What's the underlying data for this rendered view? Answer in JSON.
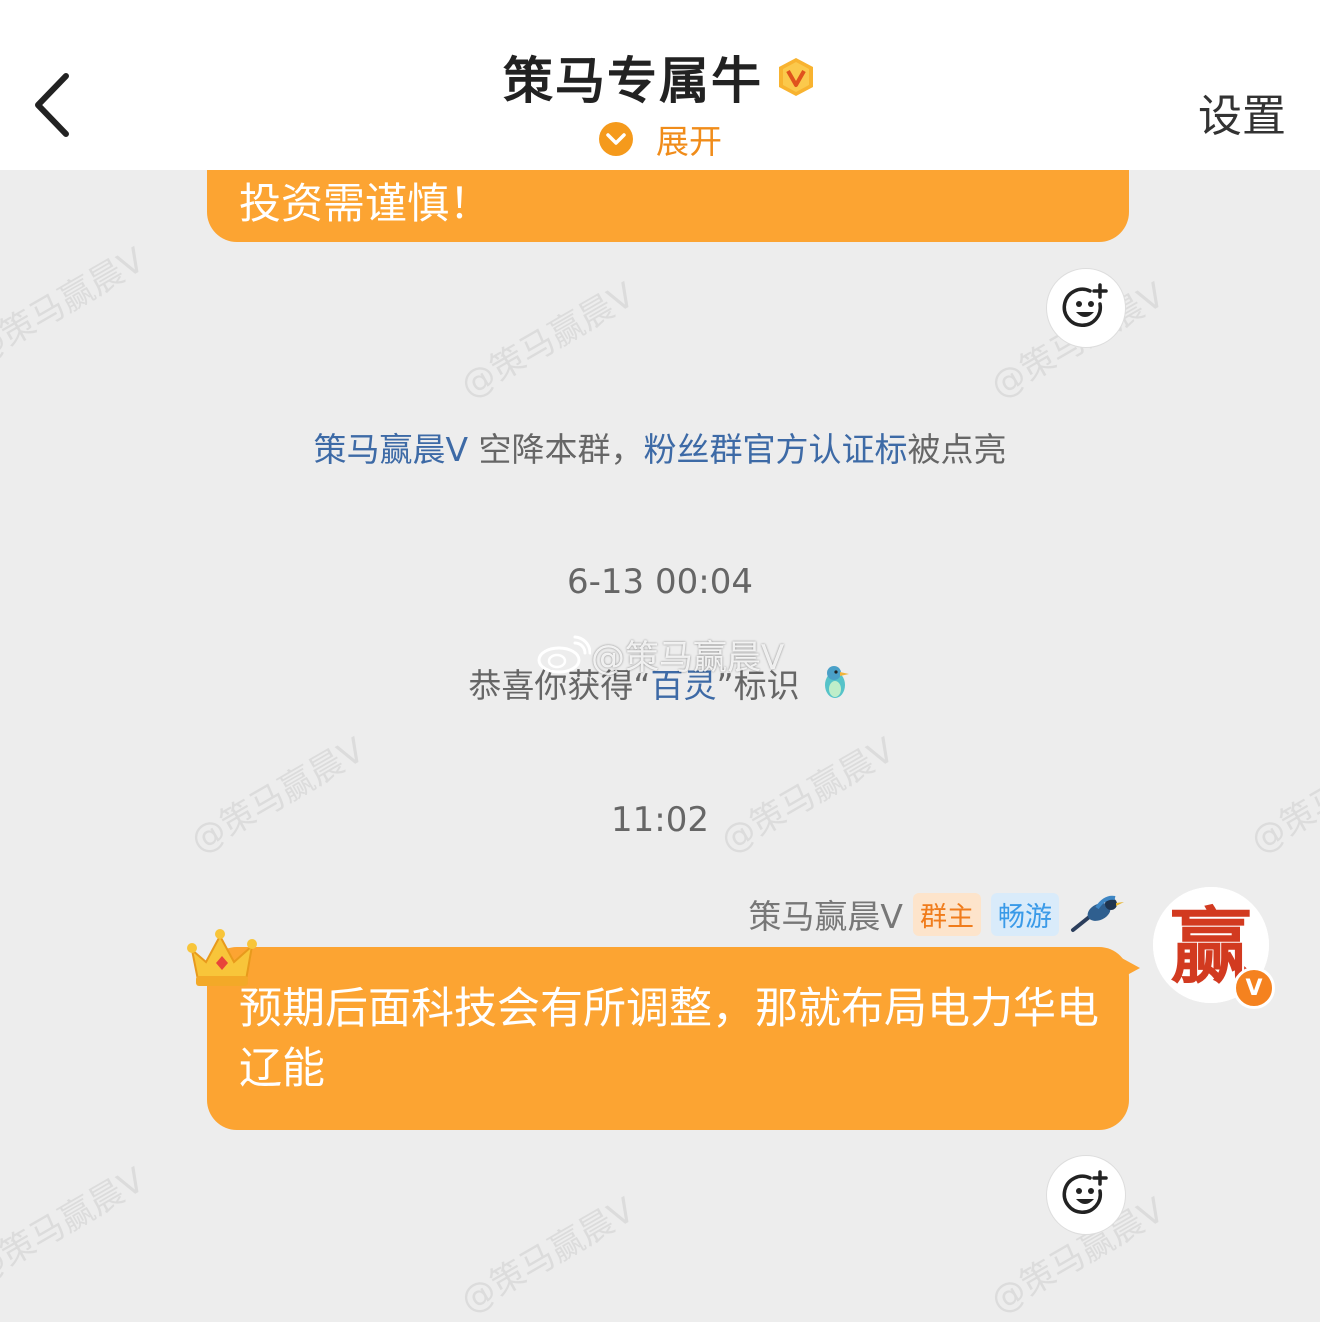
{
  "header": {
    "title": "策马专属牛",
    "expand_label": "展开",
    "settings_label": "设置"
  },
  "watermark_text": "@策马赢晨V",
  "messages": {
    "top_bubble_text": "投资需谨慎！",
    "system_notice": {
      "user": "策马赢晨Ⅴ",
      "middle": " 空降本群，",
      "badge_name": "粉丝群官方认证标",
      "tail": "被点亮"
    },
    "timestamp_1": "6-13 00:04",
    "award": {
      "prefix": "恭喜你获得“",
      "badge": "百灵",
      "suffix": "”标识"
    },
    "timestamp_2": "11:02",
    "sender": {
      "name": "策马赢晨Ⅴ",
      "tag_owner": "群主",
      "tag_travel": "畅游",
      "avatar_char": "赢",
      "avatar_badge": "V"
    },
    "main_bubble_text": "预期后面科技会有所调整，那就布局电力华电辽能"
  },
  "colors": {
    "bubble": "#fca432",
    "link": "#3d6aa6",
    "accent_orange": "#f08c1a",
    "background": "#ededed"
  }
}
